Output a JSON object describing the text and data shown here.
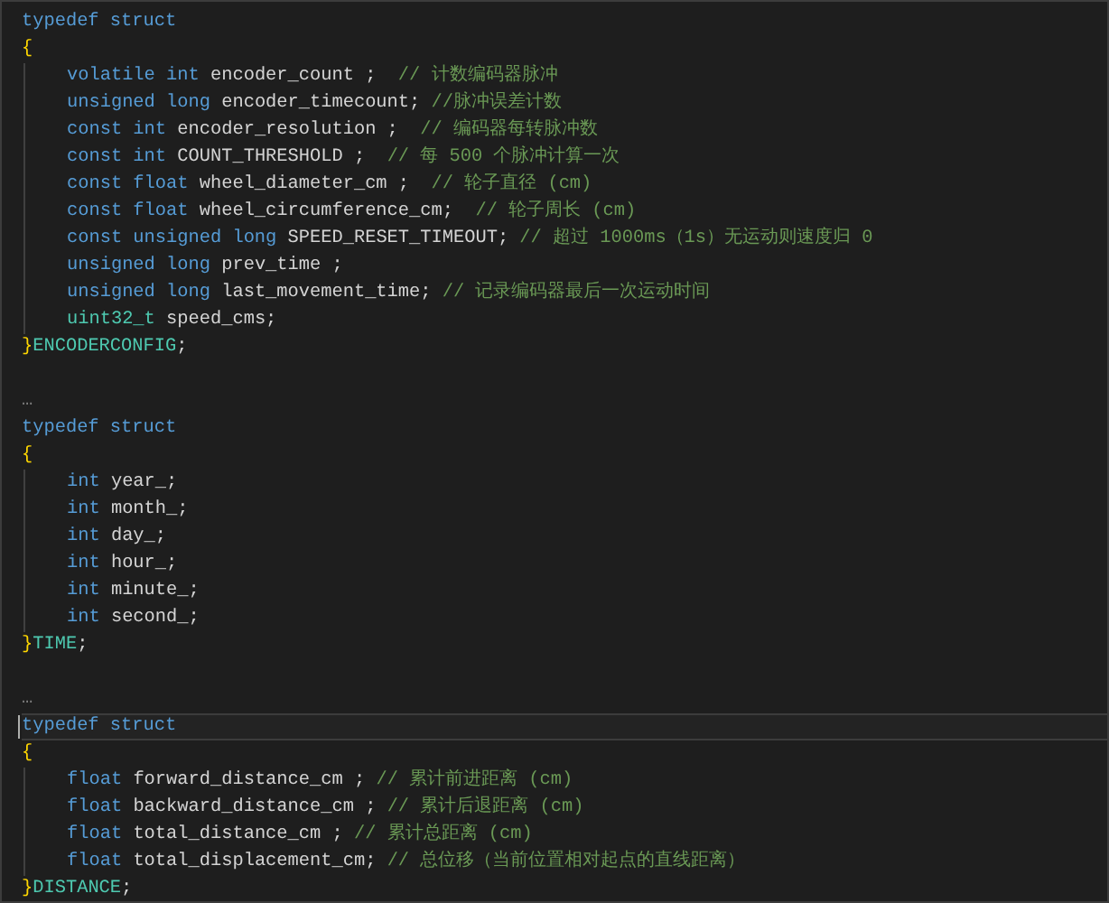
{
  "editor": {
    "lines": [
      {
        "kind": "code",
        "current": false,
        "tokens": [
          {
            "kind": "keyword",
            "text": "typedef struct"
          }
        ]
      },
      {
        "kind": "code",
        "current": false,
        "tokens": [
          {
            "kind": "brace",
            "text": "{"
          }
        ],
        "children": [
          {
            "kind": "code",
            "current": false,
            "tokens": [
              {
                "kind": "keyword",
                "text": "volatile int"
              },
              {
                "kind": "ident",
                "text": " encoder_count ;  "
              },
              {
                "kind": "comment",
                "text": "// 计数编码器脉冲"
              }
            ]
          },
          {
            "kind": "code",
            "current": false,
            "tokens": [
              {
                "kind": "keyword",
                "text": "unsigned long"
              },
              {
                "kind": "ident",
                "text": " encoder_timecount; "
              },
              {
                "kind": "comment",
                "text": "//脉冲误差计数"
              }
            ]
          },
          {
            "kind": "code",
            "current": false,
            "tokens": [
              {
                "kind": "keyword",
                "text": "const int"
              },
              {
                "kind": "ident",
                "text": " encoder_resolution ;  "
              },
              {
                "kind": "comment",
                "text": "// 编码器每转脉冲数"
              }
            ]
          },
          {
            "kind": "code",
            "current": false,
            "tokens": [
              {
                "kind": "keyword",
                "text": "const int"
              },
              {
                "kind": "ident",
                "text": " COUNT_THRESHOLD ;  "
              },
              {
                "kind": "comment",
                "text": "// 每 500 个脉冲计算一次"
              }
            ]
          },
          {
            "kind": "code",
            "current": false,
            "tokens": [
              {
                "kind": "keyword",
                "text": "const float"
              },
              {
                "kind": "ident",
                "text": " wheel_diameter_cm ;  "
              },
              {
                "kind": "comment",
                "text": "// 轮子直径 (cm)"
              }
            ]
          },
          {
            "kind": "code",
            "current": false,
            "tokens": [
              {
                "kind": "keyword",
                "text": "const float"
              },
              {
                "kind": "ident",
                "text": " wheel_circumference_cm;  "
              },
              {
                "kind": "comment",
                "text": "// 轮子周长 (cm)"
              }
            ]
          },
          {
            "kind": "code",
            "current": false,
            "tokens": [
              {
                "kind": "keyword",
                "text": "const unsigned long"
              },
              {
                "kind": "ident",
                "text": " SPEED_RESET_TIMEOUT; "
              },
              {
                "kind": "comment",
                "text": "// 超过 1000ms（1s）无运动则速度归 0"
              }
            ]
          },
          {
            "kind": "code",
            "current": false,
            "tokens": [
              {
                "kind": "keyword",
                "text": "unsigned long"
              },
              {
                "kind": "ident",
                "text": " prev_time ;"
              }
            ]
          },
          {
            "kind": "code",
            "current": false,
            "tokens": [
              {
                "kind": "keyword",
                "text": "unsigned long"
              },
              {
                "kind": "ident",
                "text": " last_movement_time; "
              },
              {
                "kind": "comment",
                "text": "// 记录编码器最后一次运动时间"
              }
            ]
          },
          {
            "kind": "code",
            "current": false,
            "tokens": [
              {
                "kind": "type",
                "text": "uint32_t"
              },
              {
                "kind": "ident",
                "text": " speed_cms;"
              }
            ]
          }
        ]
      },
      {
        "kind": "code",
        "current": false,
        "tokens": [
          {
            "kind": "brace",
            "text": "}"
          },
          {
            "kind": "type",
            "text": "ENCODERCONFIG"
          },
          {
            "kind": "ident",
            "text": ";"
          }
        ]
      },
      {
        "kind": "blank",
        "current": false
      },
      {
        "kind": "code",
        "current": false,
        "tokens": [
          {
            "kind": "fold",
            "text": "…"
          }
        ]
      },
      {
        "kind": "code",
        "current": false,
        "tokens": [
          {
            "kind": "keyword",
            "text": "typedef struct"
          }
        ]
      },
      {
        "kind": "code",
        "current": false,
        "tokens": [
          {
            "kind": "brace",
            "text": "{"
          }
        ],
        "children": [
          {
            "kind": "code",
            "current": false,
            "tokens": [
              {
                "kind": "keyword",
                "text": "int"
              },
              {
                "kind": "ident",
                "text": " year_;"
              }
            ]
          },
          {
            "kind": "code",
            "current": false,
            "tokens": [
              {
                "kind": "keyword",
                "text": "int"
              },
              {
                "kind": "ident",
                "text": " month_;"
              }
            ]
          },
          {
            "kind": "code",
            "current": false,
            "tokens": [
              {
                "kind": "keyword",
                "text": "int"
              },
              {
                "kind": "ident",
                "text": " day_;"
              }
            ]
          },
          {
            "kind": "code",
            "current": false,
            "tokens": [
              {
                "kind": "keyword",
                "text": "int"
              },
              {
                "kind": "ident",
                "text": " hour_;"
              }
            ]
          },
          {
            "kind": "code",
            "current": false,
            "tokens": [
              {
                "kind": "keyword",
                "text": "int"
              },
              {
                "kind": "ident",
                "text": " minute_;"
              }
            ]
          },
          {
            "kind": "code",
            "current": false,
            "tokens": [
              {
                "kind": "keyword",
                "text": "int"
              },
              {
                "kind": "ident",
                "text": " second_;"
              }
            ]
          }
        ]
      },
      {
        "kind": "code",
        "current": false,
        "tokens": [
          {
            "kind": "brace",
            "text": "}"
          },
          {
            "kind": "type",
            "text": "TIME"
          },
          {
            "kind": "ident",
            "text": ";"
          }
        ]
      },
      {
        "kind": "blank",
        "current": false
      },
      {
        "kind": "code",
        "current": false,
        "tokens": [
          {
            "kind": "fold",
            "text": "…"
          }
        ]
      },
      {
        "kind": "code",
        "current": true,
        "tokens": [
          {
            "kind": "keyword",
            "text": "typedef struct"
          }
        ]
      },
      {
        "kind": "code",
        "current": false,
        "tokens": [
          {
            "kind": "brace",
            "text": "{"
          }
        ],
        "children": [
          {
            "kind": "code",
            "current": false,
            "tokens": [
              {
                "kind": "keyword",
                "text": "float"
              },
              {
                "kind": "ident",
                "text": " forward_distance_cm ; "
              },
              {
                "kind": "comment",
                "text": "// 累计前进距离 (cm)"
              }
            ]
          },
          {
            "kind": "code",
            "current": false,
            "tokens": [
              {
                "kind": "keyword",
                "text": "float"
              },
              {
                "kind": "ident",
                "text": " backward_distance_cm ; "
              },
              {
                "kind": "comment",
                "text": "// 累计后退距离 (cm)"
              }
            ]
          },
          {
            "kind": "code",
            "current": false,
            "tokens": [
              {
                "kind": "keyword",
                "text": "float"
              },
              {
                "kind": "ident",
                "text": " total_distance_cm ; "
              },
              {
                "kind": "comment",
                "text": "// 累计总距离 (cm)"
              }
            ]
          },
          {
            "kind": "code",
            "current": false,
            "tokens": [
              {
                "kind": "keyword",
                "text": "float"
              },
              {
                "kind": "ident",
                "text": " total_displacement_cm; "
              },
              {
                "kind": "comment",
                "text": "// 总位移（当前位置相对起点的直线距离）"
              }
            ]
          }
        ]
      },
      {
        "kind": "code",
        "current": false,
        "tokens": [
          {
            "kind": "brace",
            "text": "}"
          },
          {
            "kind": "type",
            "text": "DISTANCE"
          },
          {
            "kind": "ident",
            "text": ";"
          }
        ]
      }
    ]
  }
}
